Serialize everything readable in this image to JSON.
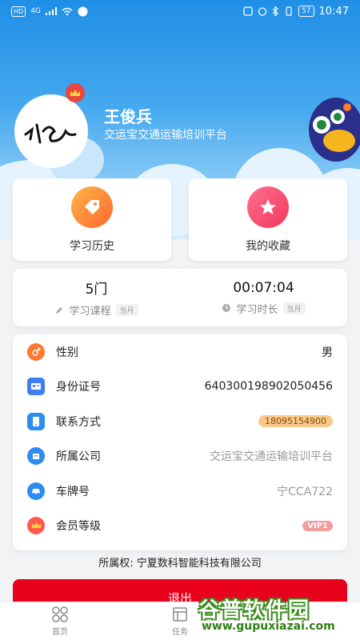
{
  "status_bar": {
    "chip": "HD",
    "signal": "4G",
    "battery": "57",
    "time": "10:47"
  },
  "profile": {
    "name": "王俊兵",
    "org": "交运宝交通运输培训平台"
  },
  "cards": [
    {
      "label": "学习历史",
      "icon": "tag-icon",
      "color": "#ff7d3a"
    },
    {
      "label": "我的收藏",
      "icon": "star-icon",
      "color": "#f2456b"
    }
  ],
  "stats": [
    {
      "value": "5门",
      "label": "学习课程",
      "tag": "当月",
      "icon": "pencil-icon"
    },
    {
      "value": "00:07:04",
      "label": "学习时长",
      "tag": "当月",
      "icon": "clock-icon"
    }
  ],
  "info": [
    {
      "key": "性别",
      "value": "男",
      "icon": "gender-icon",
      "color": "#ff7a2e"
    },
    {
      "key": "身份证号",
      "value": "640300198902050456",
      "icon": "id-card-icon",
      "color": "#3d7ef0"
    },
    {
      "key": "联系方式",
      "value": "18095154900",
      "icon": "phone-icon",
      "color": "#2d8cf0"
    },
    {
      "key": "所属公司",
      "value": "交运宝交通运输培训平台",
      "icon": "company-icon",
      "color": "#2d8cf0"
    },
    {
      "key": "车牌号",
      "value": "宁CCA722",
      "icon": "car-icon",
      "color": "#2d8cf0"
    },
    {
      "key": "会员等级",
      "value": "VIP1",
      "icon": "crown-icon",
      "color": "#ff5a4e"
    }
  ],
  "ownership": "所属权:  宁夏数科智能科技有限公司",
  "logout_label": "退出",
  "tabs": [
    {
      "label": "首页",
      "icon": "home-icon"
    },
    {
      "label": "任务",
      "icon": "task-icon"
    }
  ],
  "watermark": {
    "title": "谷普软件园",
    "url": "www.gupuxiazai.com"
  }
}
